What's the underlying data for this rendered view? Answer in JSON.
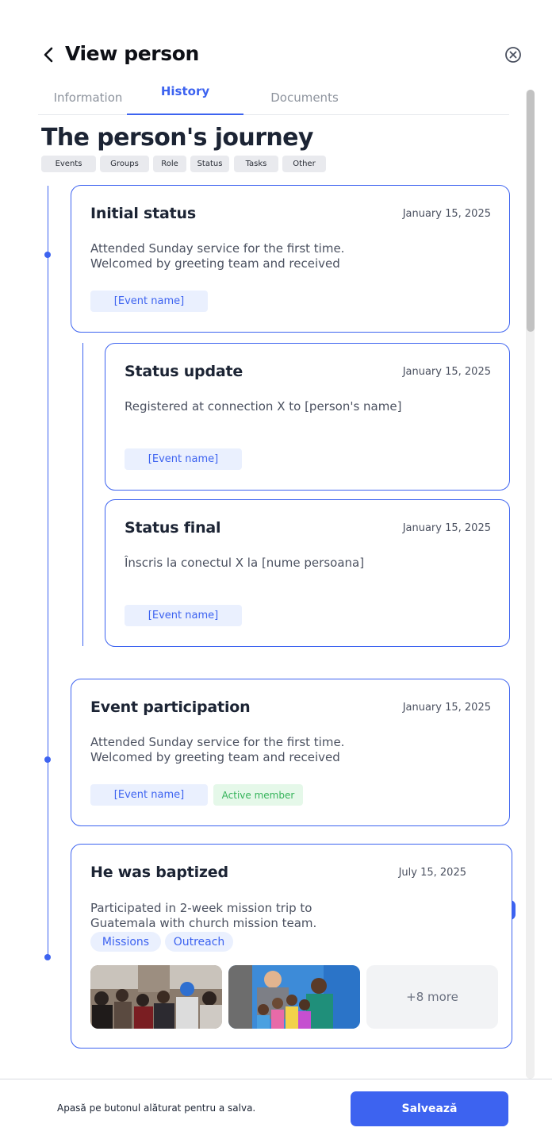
{
  "header": {
    "title": "View person",
    "back_icon": "chevron-left-icon",
    "close_icon": "close-circle-icon"
  },
  "tabs": [
    {
      "label": "Information",
      "active": false
    },
    {
      "label": "History",
      "active": true
    },
    {
      "label": "Documents",
      "active": false
    }
  ],
  "journey": {
    "title": "The person's journey",
    "filters": [
      "Events",
      "Groups",
      "Role",
      "Status",
      "Tasks",
      "Other"
    ]
  },
  "cards": [
    {
      "title": "Initial status",
      "date": "January 15, 2025",
      "description": [
        "Attended Sunday service for the first time.",
        "Welcomed by greeting team and received"
      ],
      "tags": [
        "[Event name]"
      ]
    },
    {
      "title": "Status update",
      "date": "January 15, 2025",
      "description": [
        "Registered at connection X to [person's name]"
      ],
      "tags": [
        "[Event name]"
      ]
    },
    {
      "title": "Status final",
      "date": "January 15, 2025",
      "description": [
        "Înscris la conectul X la [nume persoana]"
      ],
      "tags": [
        "[Event name]"
      ]
    },
    {
      "title": "Event participation",
      "date": "January 15, 2025",
      "description": [
        "Attended Sunday service for the first time.",
        "Welcomed by greeting team and received"
      ],
      "tags": [
        "[Event name]",
        "Active member"
      ]
    },
    {
      "title": "He was baptized",
      "date": "July 15, 2025",
      "description": [
        "Participated in 2-week mission trip to",
        "Guatemala with church mission team."
      ],
      "tags": [
        "Missions",
        "Outreach"
      ],
      "more_photos": "+8 more"
    }
  ],
  "footer": {
    "hint": "Apasă pe butonul alăturat pentru a salva.",
    "save_label": "Salvează"
  },
  "colors": {
    "accent": "#3d63f0",
    "tag_bg": "#eaf0fe",
    "success_text": "#35b35a",
    "success_bg": "#e5f8e9"
  }
}
